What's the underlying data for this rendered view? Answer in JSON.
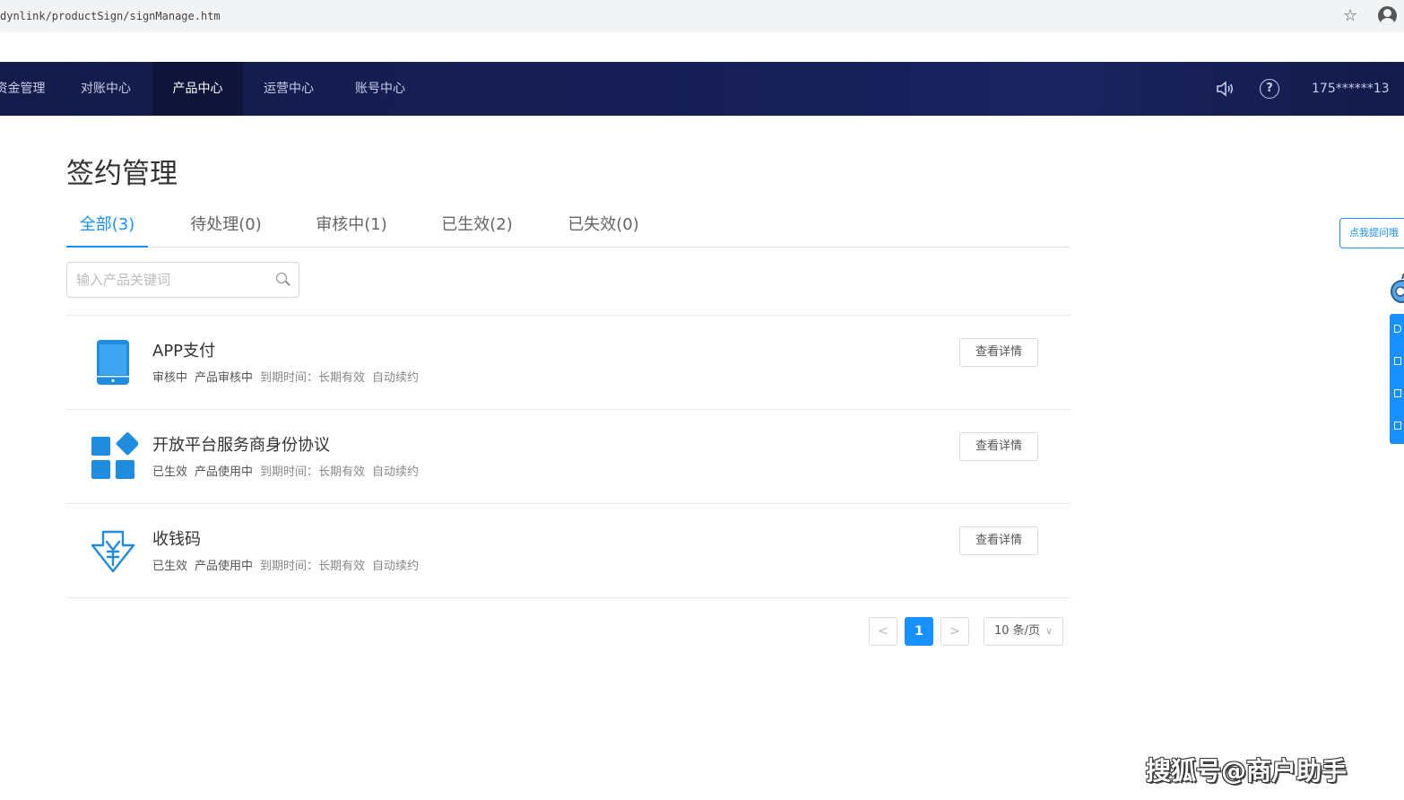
{
  "browser": {
    "url": "dynlink/productSign/signManage.htm"
  },
  "topnav": {
    "items": [
      {
        "label": "资金管理"
      },
      {
        "label": "对账中心"
      },
      {
        "label": "产品中心",
        "active": true
      },
      {
        "label": "运营中心"
      },
      {
        "label": "账号中心"
      }
    ],
    "user": "175******13",
    "icons": [
      "speaker-icon",
      "help-icon"
    ]
  },
  "page": {
    "title": "签约管理"
  },
  "tabs": [
    {
      "label": "全部(3)",
      "active": true
    },
    {
      "label": "待处理(0)"
    },
    {
      "label": "审核中(1)"
    },
    {
      "label": "已生效(2)"
    },
    {
      "label": "已失效(0)"
    }
  ],
  "search": {
    "placeholder": "输入产品关键词",
    "value": ""
  },
  "products": [
    {
      "name": "APP支付",
      "status": "审核中",
      "state": "产品审核中",
      "expiry": "到期时间：长期有效",
      "renew": "自动续约",
      "icon": "phone-icon",
      "action": "查看详情"
    },
    {
      "name": "开放平台服务商身份协议",
      "status": "已生效",
      "state": "产品使用中",
      "expiry": "到期时间：长期有效",
      "renew": "自动续约",
      "icon": "apps-grid-icon",
      "action": "查看详情"
    },
    {
      "name": "收钱码",
      "status": "已生效",
      "state": "产品使用中",
      "expiry": "到期时间：长期有效",
      "renew": "自动续约",
      "icon": "yuan-code-icon",
      "action": "查看详情"
    }
  ],
  "pagination": {
    "current": "1",
    "prev": "<",
    "next": ">",
    "page_size": "10 条/页"
  },
  "floating": {
    "tip": "点我提问哦"
  },
  "watermark": "搜狐号@商户助手",
  "colors": {
    "nav_bg": "#18205a",
    "accent": "#1890ff",
    "icon_blue": "#1f8ce0"
  }
}
